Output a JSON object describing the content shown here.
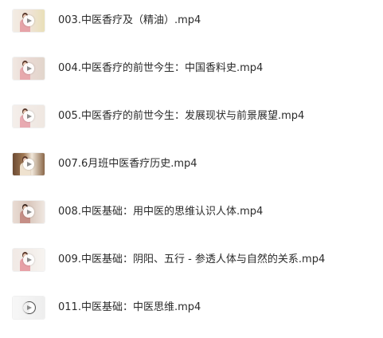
{
  "files": [
    {
      "name": "003.中医香疗及（精油）.mp4"
    },
    {
      "name": "004.中医香疗的前世今生：中国香料史.mp4"
    },
    {
      "name": "005.中医香疗的前世今生：发展现状与前景展望.mp4"
    },
    {
      "name": "007.6月班中医香疗历史.mp4"
    },
    {
      "name": "008.中医基础：用中医的思维认识人体.mp4"
    },
    {
      "name": "009.中医基础：阴阳、五行 - 参透人体与自然的关系.mp4"
    },
    {
      "name": "011.中医基础：中医思维.mp4"
    }
  ],
  "thumb_icon": "video-play-icon"
}
